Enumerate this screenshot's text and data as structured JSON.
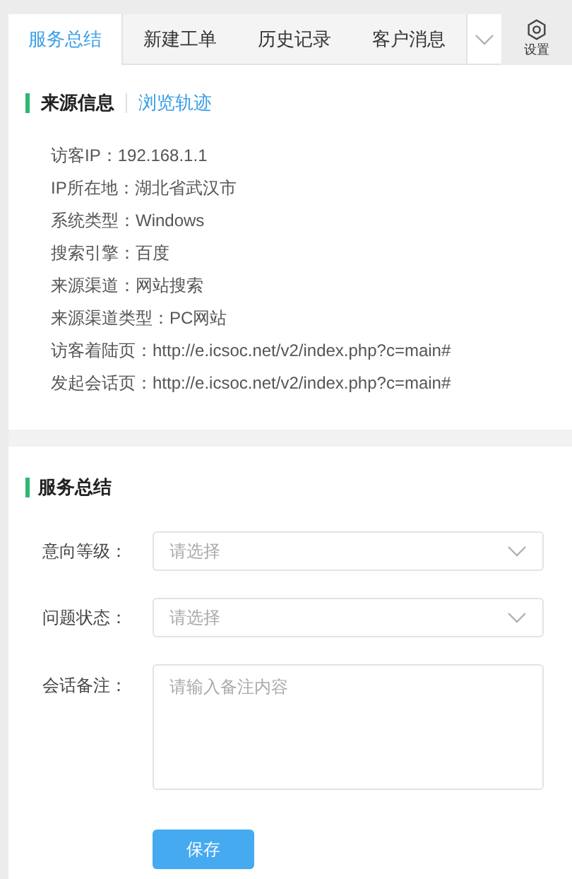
{
  "tabs": [
    {
      "label": "服务总结",
      "selected": true
    },
    {
      "label": "新建工单",
      "selected": false
    },
    {
      "label": "历史记录",
      "selected": false
    },
    {
      "label": "客户消息",
      "selected": false
    }
  ],
  "settings": {
    "label": "设置"
  },
  "source_section": {
    "subtabs": [
      {
        "label": "来源信息",
        "selected": true
      },
      {
        "label": "浏览轨迹",
        "selected": false
      }
    ],
    "rows": [
      {
        "label": "访客IP：",
        "value": "192.168.1.1"
      },
      {
        "label": "IP所在地：",
        "value": "湖北省武汉市"
      },
      {
        "label": "系统类型：",
        "value": "Windows"
      },
      {
        "label": "搜索引擎：",
        "value": "百度"
      },
      {
        "label": "来源渠道：",
        "value": "网站搜索"
      },
      {
        "label": "来源渠道类型：",
        "value": "PC网站"
      },
      {
        "label": "访客着陆页：",
        "value": "http://e.icsoc.net/v2/index.php?c=main#"
      },
      {
        "label": "发起会话页：",
        "value": "http://e.icsoc.net/v2/index.php?c=main#"
      }
    ]
  },
  "summary_section": {
    "title": "服务总结",
    "fields": [
      {
        "kind": "select",
        "label": "意向等级：",
        "placeholder": "请选择"
      },
      {
        "kind": "select",
        "label": "问题状态：",
        "placeholder": "请选择"
      },
      {
        "kind": "textarea",
        "label": "会话备注：",
        "placeholder": "请输入备注内容"
      }
    ],
    "save_button": "保存"
  }
}
